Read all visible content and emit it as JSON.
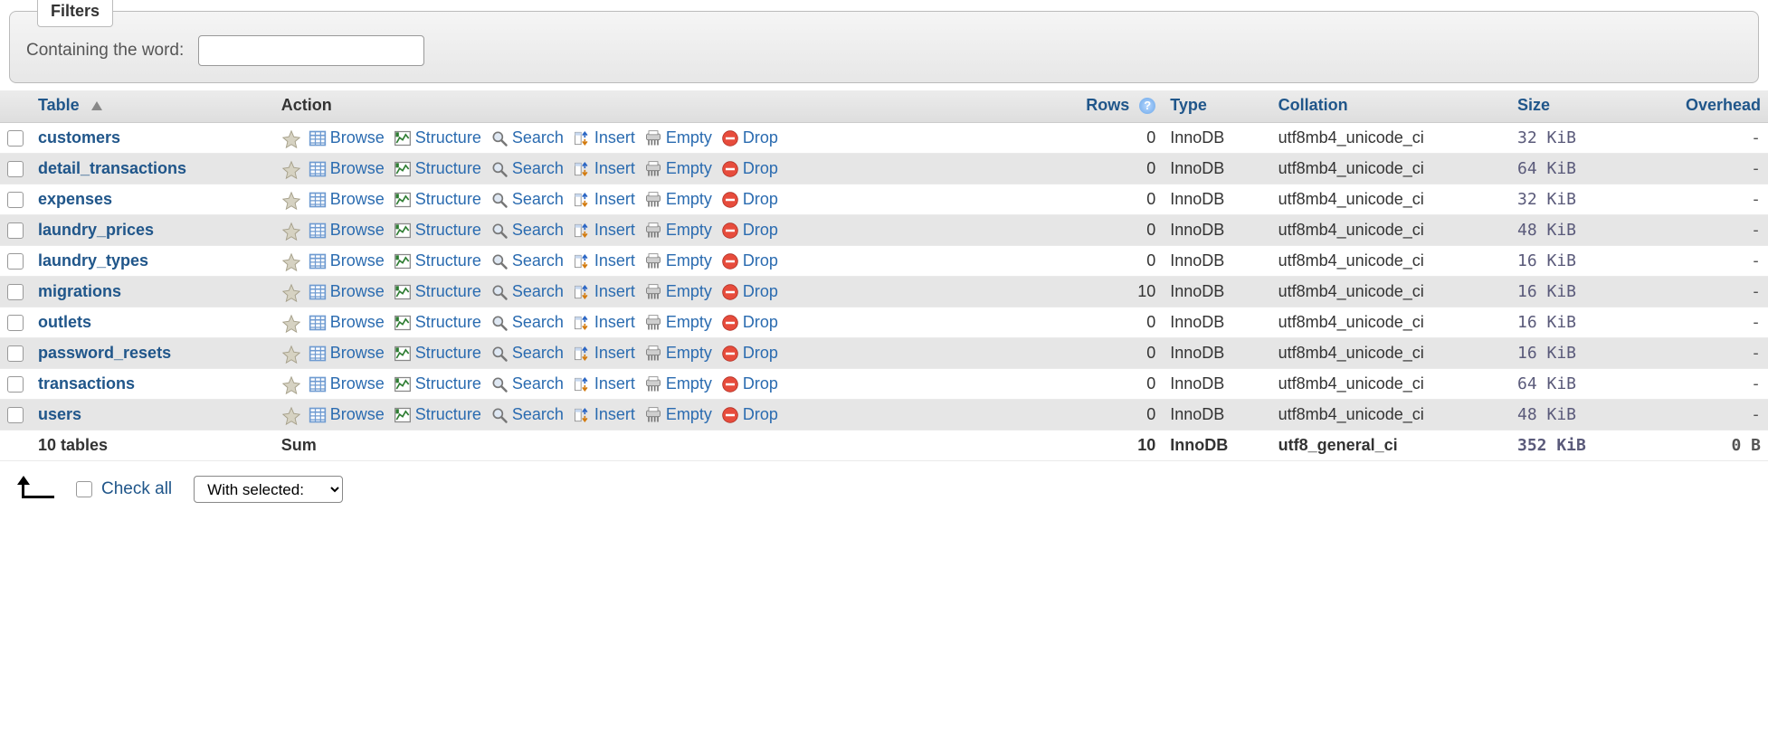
{
  "filters": {
    "legend": "Filters",
    "label": "Containing the word:",
    "value": ""
  },
  "columns": {
    "table": "Table",
    "action": "Action",
    "rows": "Rows",
    "type": "Type",
    "collation": "Collation",
    "size": "Size",
    "overhead": "Overhead"
  },
  "actions": {
    "browse": "Browse",
    "structure": "Structure",
    "search": "Search",
    "insert": "Insert",
    "empty": "Empty",
    "drop": "Drop"
  },
  "tables": [
    {
      "name": "customers",
      "rows": 0,
      "type": "InnoDB",
      "collation": "utf8mb4_unicode_ci",
      "size": "32 KiB",
      "overhead": "-"
    },
    {
      "name": "detail_transactions",
      "rows": 0,
      "type": "InnoDB",
      "collation": "utf8mb4_unicode_ci",
      "size": "64 KiB",
      "overhead": "-"
    },
    {
      "name": "expenses",
      "rows": 0,
      "type": "InnoDB",
      "collation": "utf8mb4_unicode_ci",
      "size": "32 KiB",
      "overhead": "-"
    },
    {
      "name": "laundry_prices",
      "rows": 0,
      "type": "InnoDB",
      "collation": "utf8mb4_unicode_ci",
      "size": "48 KiB",
      "overhead": "-"
    },
    {
      "name": "laundry_types",
      "rows": 0,
      "type": "InnoDB",
      "collation": "utf8mb4_unicode_ci",
      "size": "16 KiB",
      "overhead": "-"
    },
    {
      "name": "migrations",
      "rows": 10,
      "type": "InnoDB",
      "collation": "utf8mb4_unicode_ci",
      "size": "16 KiB",
      "overhead": "-"
    },
    {
      "name": "outlets",
      "rows": 0,
      "type": "InnoDB",
      "collation": "utf8mb4_unicode_ci",
      "size": "16 KiB",
      "overhead": "-"
    },
    {
      "name": "password_resets",
      "rows": 0,
      "type": "InnoDB",
      "collation": "utf8mb4_unicode_ci",
      "size": "16 KiB",
      "overhead": "-"
    },
    {
      "name": "transactions",
      "rows": 0,
      "type": "InnoDB",
      "collation": "utf8mb4_unicode_ci",
      "size": "64 KiB",
      "overhead": "-"
    },
    {
      "name": "users",
      "rows": 0,
      "type": "InnoDB",
      "collation": "utf8mb4_unicode_ci",
      "size": "48 KiB",
      "overhead": "-"
    }
  ],
  "summary": {
    "label": "10 tables",
    "action": "Sum",
    "rows": 10,
    "type": "InnoDB",
    "collation": "utf8_general_ci",
    "size": "352 KiB",
    "overhead": "0 B"
  },
  "footer": {
    "check_all": "Check all",
    "with_selected": "With selected:"
  }
}
